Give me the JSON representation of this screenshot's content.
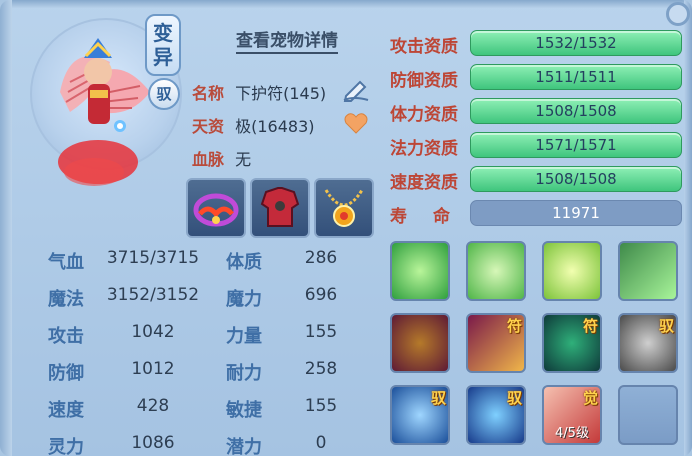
{
  "pet": {
    "variant_tag": "变异",
    "variant_tag_1": "变",
    "variant_tag_2": "异",
    "tamed_tag": "驭",
    "detail_link": "查看宠物详情",
    "name_label": "名称",
    "name_value": "下护符(145)",
    "talent_label": "天资",
    "talent_value": "极(16483)",
    "bloodline_label": "血脉",
    "bloodline_value": "无",
    "portrait_icon": "pet-portrait-fan-warrior",
    "equipment_icons": [
      "crown-equip-icon",
      "armor-equip-icon",
      "necklace-equip-icon"
    ]
  },
  "stats": [
    {
      "label": "气血",
      "value": "3715/3715",
      "label2": "体质",
      "value2": "286"
    },
    {
      "label": "魔法",
      "value": "3152/3152",
      "label2": "魔力",
      "value2": "696"
    },
    {
      "label": "攻击",
      "value": "1042",
      "label2": "力量",
      "value2": "155"
    },
    {
      "label": "防御",
      "value": "1012",
      "label2": "耐力",
      "value2": "258"
    },
    {
      "label": "速度",
      "value": "428",
      "label2": "敏捷",
      "value2": "155"
    },
    {
      "label": "灵力",
      "value": "1086",
      "label2": "潜力",
      "value2": "0"
    }
  ],
  "aptitudes": [
    {
      "label": "攻击资质",
      "value": "1532/1532",
      "fill": 1.0
    },
    {
      "label": "防御资质",
      "value": "1511/1511",
      "fill": 1.0
    },
    {
      "label": "体力资质",
      "value": "1508/1508",
      "fill": 1.0
    },
    {
      "label": "法力资质",
      "value": "1571/1571",
      "fill": 1.0
    },
    {
      "label": "速度资质",
      "value": "1508/1508",
      "fill": 1.0
    }
  ],
  "life": {
    "label": "寿命",
    "value": "11971"
  },
  "skills": [
    {
      "icon": "green-figure-skill-icon",
      "corner": "",
      "level": ""
    },
    {
      "icon": "hand-scroll-skill-icon",
      "corner": "",
      "level": ""
    },
    {
      "icon": "praying-hand-skill-icon",
      "corner": "",
      "level": ""
    },
    {
      "icon": "green-burst-skill-icon",
      "corner": "",
      "level": ""
    },
    {
      "icon": "golden-beast-skill-icon",
      "corner": "",
      "level": ""
    },
    {
      "icon": "talisman-strike-skill-icon",
      "corner": "符",
      "level": ""
    },
    {
      "icon": "green-cat-skill-icon",
      "corner": "符",
      "level": ""
    },
    {
      "icon": "gray-beast-skill-icon",
      "corner": "驭",
      "level": ""
    },
    {
      "icon": "shield-skill-icon",
      "corner": "驭",
      "level": ""
    },
    {
      "icon": "bubbles-skill-icon",
      "corner": "驭",
      "level": ""
    },
    {
      "icon": "red-awaken-skill-icon",
      "corner": "觉",
      "level": "4/5级"
    },
    {
      "icon": "empty-skill-slot",
      "corner": "",
      "level": ""
    }
  ],
  "colors": {
    "bar_green": "#4fcf88",
    "label_red": "#bd4636",
    "stat_blue": "#3f6fa6",
    "panel_bg": "#b0cce8"
  }
}
